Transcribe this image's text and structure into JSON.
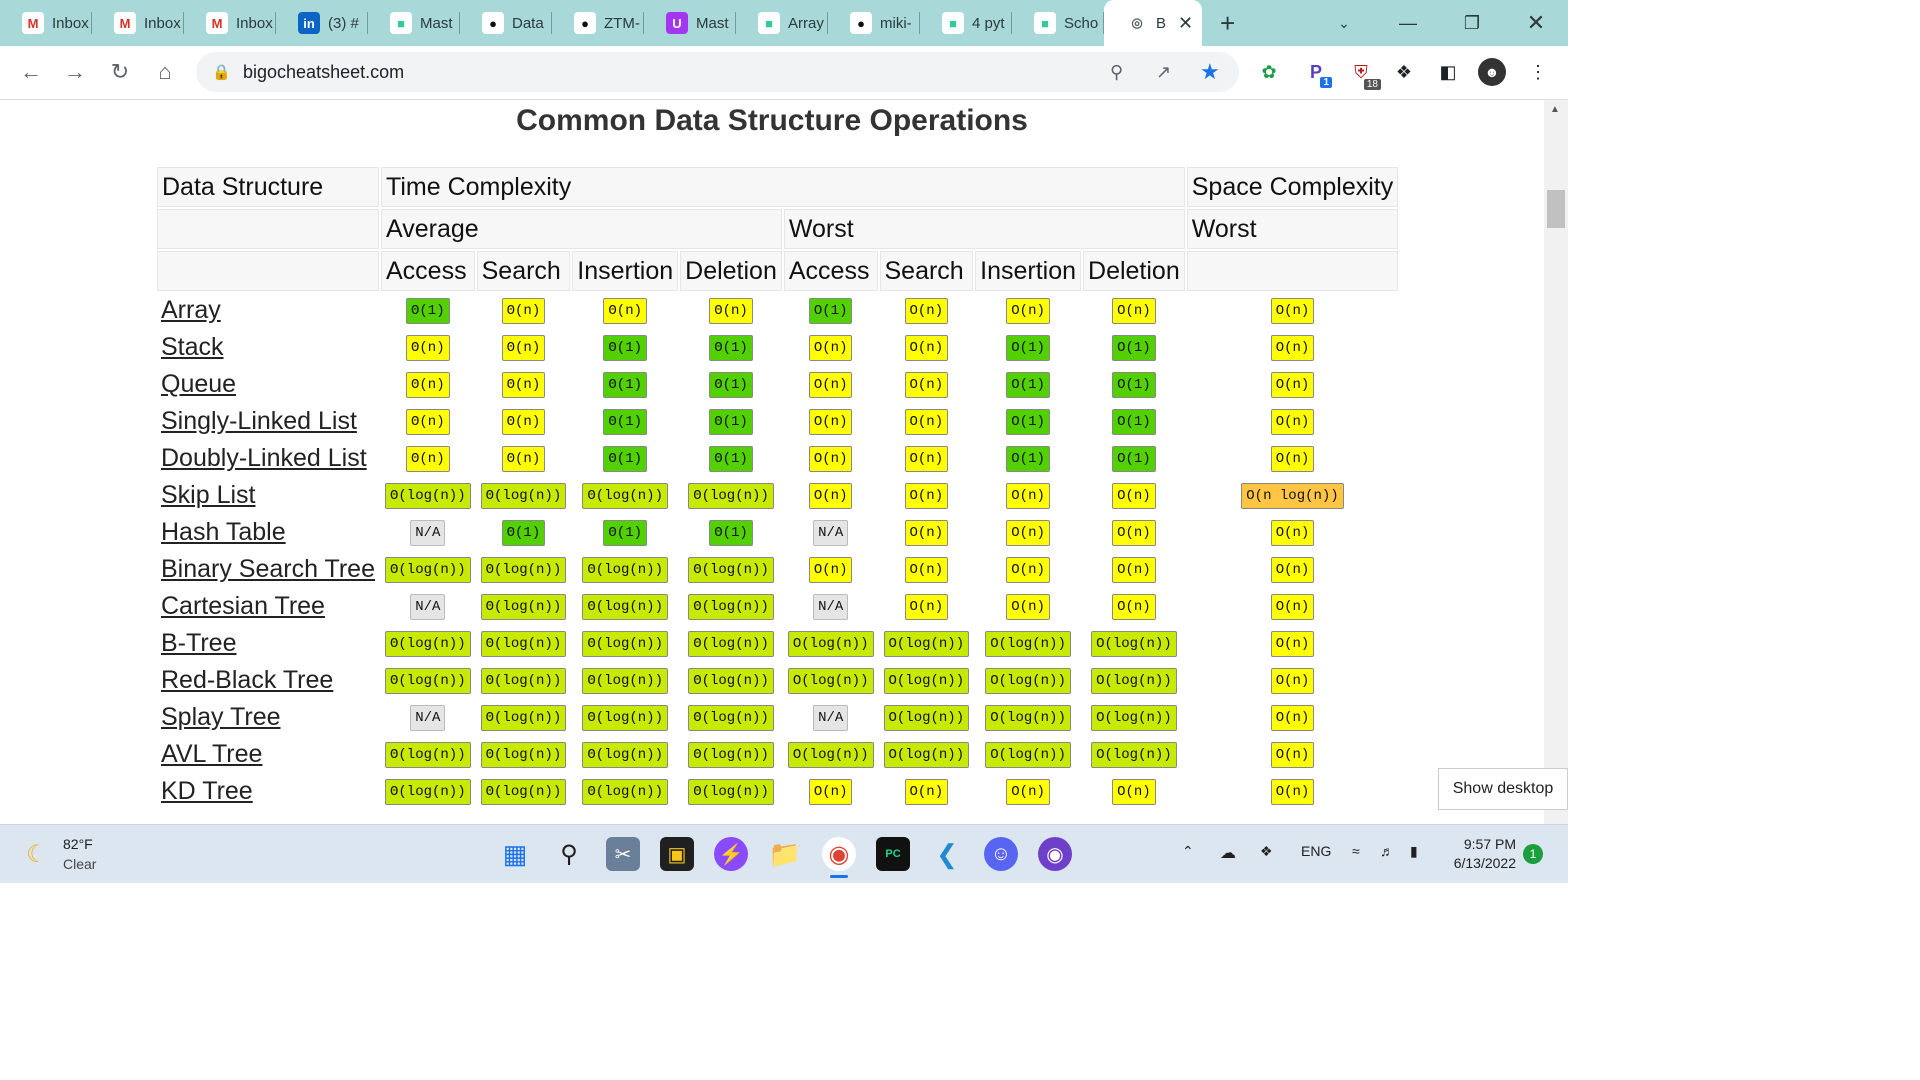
{
  "browser": {
    "tabs": [
      {
        "label": "Inbox",
        "icon": "gmail-icon"
      },
      {
        "label": "Inbox",
        "icon": "gmail-icon"
      },
      {
        "label": "Inbox",
        "icon": "gmail-icon"
      },
      {
        "label": "(3) #",
        "icon": "linkedin-icon"
      },
      {
        "label": "Mast",
        "icon": "page-icon"
      },
      {
        "label": "Data",
        "icon": "github-icon"
      },
      {
        "label": "ZTM-",
        "icon": "github-icon"
      },
      {
        "label": "Mast",
        "icon": "udemy-icon"
      },
      {
        "label": "Array",
        "icon": "page-icon"
      },
      {
        "label": "miki-",
        "icon": "github-icon"
      },
      {
        "label": "4 pyt",
        "icon": "page-icon"
      },
      {
        "label": "Scho",
        "icon": "page-icon"
      },
      {
        "label": "B",
        "icon": "globe-icon",
        "active": true
      }
    ],
    "url": "bigocheatsheet.com",
    "extension_badges": {
      "first": "1",
      "second": "18"
    }
  },
  "page": {
    "title": "Common Data Structure Operations",
    "headers": {
      "data_structure": "Data Structure",
      "time_complexity": "Time Complexity",
      "space_complexity": "Space Complexity",
      "average": "Average",
      "worst": "Worst",
      "space_worst": "Worst",
      "ops": [
        "Access",
        "Search",
        "Insertion",
        "Deletion",
        "Access",
        "Search",
        "Insertion",
        "Deletion"
      ]
    },
    "rows": [
      {
        "name": "Array",
        "cells": [
          [
            "Θ(1)",
            "excellent"
          ],
          [
            "Θ(n)",
            "fair"
          ],
          [
            "Θ(n)",
            "fair"
          ],
          [
            "Θ(n)",
            "fair"
          ],
          [
            "O(1)",
            "excellent"
          ],
          [
            "O(n)",
            "fair"
          ],
          [
            "O(n)",
            "fair"
          ],
          [
            "O(n)",
            "fair"
          ],
          [
            "O(n)",
            "fair"
          ]
        ]
      },
      {
        "name": "Stack",
        "cells": [
          [
            "Θ(n)",
            "fair"
          ],
          [
            "Θ(n)",
            "fair"
          ],
          [
            "Θ(1)",
            "excellent"
          ],
          [
            "Θ(1)",
            "excellent"
          ],
          [
            "O(n)",
            "fair"
          ],
          [
            "O(n)",
            "fair"
          ],
          [
            "O(1)",
            "excellent"
          ],
          [
            "O(1)",
            "excellent"
          ],
          [
            "O(n)",
            "fair"
          ]
        ]
      },
      {
        "name": "Queue",
        "cells": [
          [
            "Θ(n)",
            "fair"
          ],
          [
            "Θ(n)",
            "fair"
          ],
          [
            "Θ(1)",
            "excellent"
          ],
          [
            "Θ(1)",
            "excellent"
          ],
          [
            "O(n)",
            "fair"
          ],
          [
            "O(n)",
            "fair"
          ],
          [
            "O(1)",
            "excellent"
          ],
          [
            "O(1)",
            "excellent"
          ],
          [
            "O(n)",
            "fair"
          ]
        ]
      },
      {
        "name": "Singly-Linked List",
        "cells": [
          [
            "Θ(n)",
            "fair"
          ],
          [
            "Θ(n)",
            "fair"
          ],
          [
            "Θ(1)",
            "excellent"
          ],
          [
            "Θ(1)",
            "excellent"
          ],
          [
            "O(n)",
            "fair"
          ],
          [
            "O(n)",
            "fair"
          ],
          [
            "O(1)",
            "excellent"
          ],
          [
            "O(1)",
            "excellent"
          ],
          [
            "O(n)",
            "fair"
          ]
        ]
      },
      {
        "name": "Doubly-Linked List",
        "cells": [
          [
            "Θ(n)",
            "fair"
          ],
          [
            "Θ(n)",
            "fair"
          ],
          [
            "Θ(1)",
            "excellent"
          ],
          [
            "Θ(1)",
            "excellent"
          ],
          [
            "O(n)",
            "fair"
          ],
          [
            "O(n)",
            "fair"
          ],
          [
            "O(1)",
            "excellent"
          ],
          [
            "O(1)",
            "excellent"
          ],
          [
            "O(n)",
            "fair"
          ]
        ]
      },
      {
        "name": "Skip List",
        "cells": [
          [
            "Θ(log(n))",
            "good"
          ],
          [
            "Θ(log(n))",
            "good"
          ],
          [
            "Θ(log(n))",
            "good"
          ],
          [
            "Θ(log(n))",
            "good"
          ],
          [
            "O(n)",
            "fair"
          ],
          [
            "O(n)",
            "fair"
          ],
          [
            "O(n)",
            "fair"
          ],
          [
            "O(n)",
            "fair"
          ],
          [
            "O(n log(n))",
            "bad"
          ]
        ]
      },
      {
        "name": "Hash Table",
        "cells": [
          [
            "N/A",
            "na"
          ],
          [
            "Θ(1)",
            "excellent"
          ],
          [
            "Θ(1)",
            "excellent"
          ],
          [
            "Θ(1)",
            "excellent"
          ],
          [
            "N/A",
            "na"
          ],
          [
            "O(n)",
            "fair"
          ],
          [
            "O(n)",
            "fair"
          ],
          [
            "O(n)",
            "fair"
          ],
          [
            "O(n)",
            "fair"
          ]
        ]
      },
      {
        "name": "Binary Search Tree",
        "cells": [
          [
            "Θ(log(n))",
            "good"
          ],
          [
            "Θ(log(n))",
            "good"
          ],
          [
            "Θ(log(n))",
            "good"
          ],
          [
            "Θ(log(n))",
            "good"
          ],
          [
            "O(n)",
            "fair"
          ],
          [
            "O(n)",
            "fair"
          ],
          [
            "O(n)",
            "fair"
          ],
          [
            "O(n)",
            "fair"
          ],
          [
            "O(n)",
            "fair"
          ]
        ]
      },
      {
        "name": "Cartesian Tree",
        "cells": [
          [
            "N/A",
            "na"
          ],
          [
            "Θ(log(n))",
            "good"
          ],
          [
            "Θ(log(n))",
            "good"
          ],
          [
            "Θ(log(n))",
            "good"
          ],
          [
            "N/A",
            "na"
          ],
          [
            "O(n)",
            "fair"
          ],
          [
            "O(n)",
            "fair"
          ],
          [
            "O(n)",
            "fair"
          ],
          [
            "O(n)",
            "fair"
          ]
        ]
      },
      {
        "name": "B-Tree",
        "cells": [
          [
            "Θ(log(n))",
            "good"
          ],
          [
            "Θ(log(n))",
            "good"
          ],
          [
            "Θ(log(n))",
            "good"
          ],
          [
            "Θ(log(n))",
            "good"
          ],
          [
            "O(log(n))",
            "good"
          ],
          [
            "O(log(n))",
            "good"
          ],
          [
            "O(log(n))",
            "good"
          ],
          [
            "O(log(n))",
            "good"
          ],
          [
            "O(n)",
            "fair"
          ]
        ]
      },
      {
        "name": "Red-Black Tree",
        "cells": [
          [
            "Θ(log(n))",
            "good"
          ],
          [
            "Θ(log(n))",
            "good"
          ],
          [
            "Θ(log(n))",
            "good"
          ],
          [
            "Θ(log(n))",
            "good"
          ],
          [
            "O(log(n))",
            "good"
          ],
          [
            "O(log(n))",
            "good"
          ],
          [
            "O(log(n))",
            "good"
          ],
          [
            "O(log(n))",
            "good"
          ],
          [
            "O(n)",
            "fair"
          ]
        ]
      },
      {
        "name": "Splay Tree",
        "cells": [
          [
            "N/A",
            "na"
          ],
          [
            "Θ(log(n))",
            "good"
          ],
          [
            "Θ(log(n))",
            "good"
          ],
          [
            "Θ(log(n))",
            "good"
          ],
          [
            "N/A",
            "na"
          ],
          [
            "O(log(n))",
            "good"
          ],
          [
            "O(log(n))",
            "good"
          ],
          [
            "O(log(n))",
            "good"
          ],
          [
            "O(n)",
            "fair"
          ]
        ]
      },
      {
        "name": "AVL Tree",
        "cells": [
          [
            "Θ(log(n))",
            "good"
          ],
          [
            "Θ(log(n))",
            "good"
          ],
          [
            "Θ(log(n))",
            "good"
          ],
          [
            "Θ(log(n))",
            "good"
          ],
          [
            "O(log(n))",
            "good"
          ],
          [
            "O(log(n))",
            "good"
          ],
          [
            "O(log(n))",
            "good"
          ],
          [
            "O(log(n))",
            "good"
          ],
          [
            "O(n)",
            "fair"
          ]
        ]
      },
      {
        "name": "KD Tree",
        "cells": [
          [
            "Θ(log(n))",
            "good"
          ],
          [
            "Θ(log(n))",
            "good"
          ],
          [
            "Θ(log(n))",
            "good"
          ],
          [
            "Θ(log(n))",
            "good"
          ],
          [
            "O(n)",
            "fair"
          ],
          [
            "O(n)",
            "fair"
          ],
          [
            "O(n)",
            "fair"
          ],
          [
            "O(n)",
            "fair"
          ],
          [
            "O(n)",
            "fair"
          ]
        ]
      }
    ],
    "complexity_colors": {
      "excellent": "#53d000",
      "good": "#c8ea00",
      "fair": "#ffff00",
      "bad": "#ffc543",
      "na": "#e5e5e5"
    }
  },
  "tooltip": {
    "text": "Show desktop"
  },
  "taskbar": {
    "weather": {
      "temp": "82°F",
      "condition": "Clear",
      "icon": "moon-icon"
    },
    "apps": [
      "windows-start-icon",
      "search-icon",
      "snipping-tool-icon",
      "sticky-notes-icon",
      "messenger-icon",
      "file-explorer-icon",
      "chrome-icon",
      "pycharm-icon",
      "vscode-icon",
      "discord-icon",
      "github-desktop-icon"
    ],
    "pycharm_label": "PC",
    "tray": {
      "language": "ENG"
    },
    "clock": {
      "time": "9:57 PM",
      "date": "6/13/2022"
    },
    "notifications": "1"
  }
}
